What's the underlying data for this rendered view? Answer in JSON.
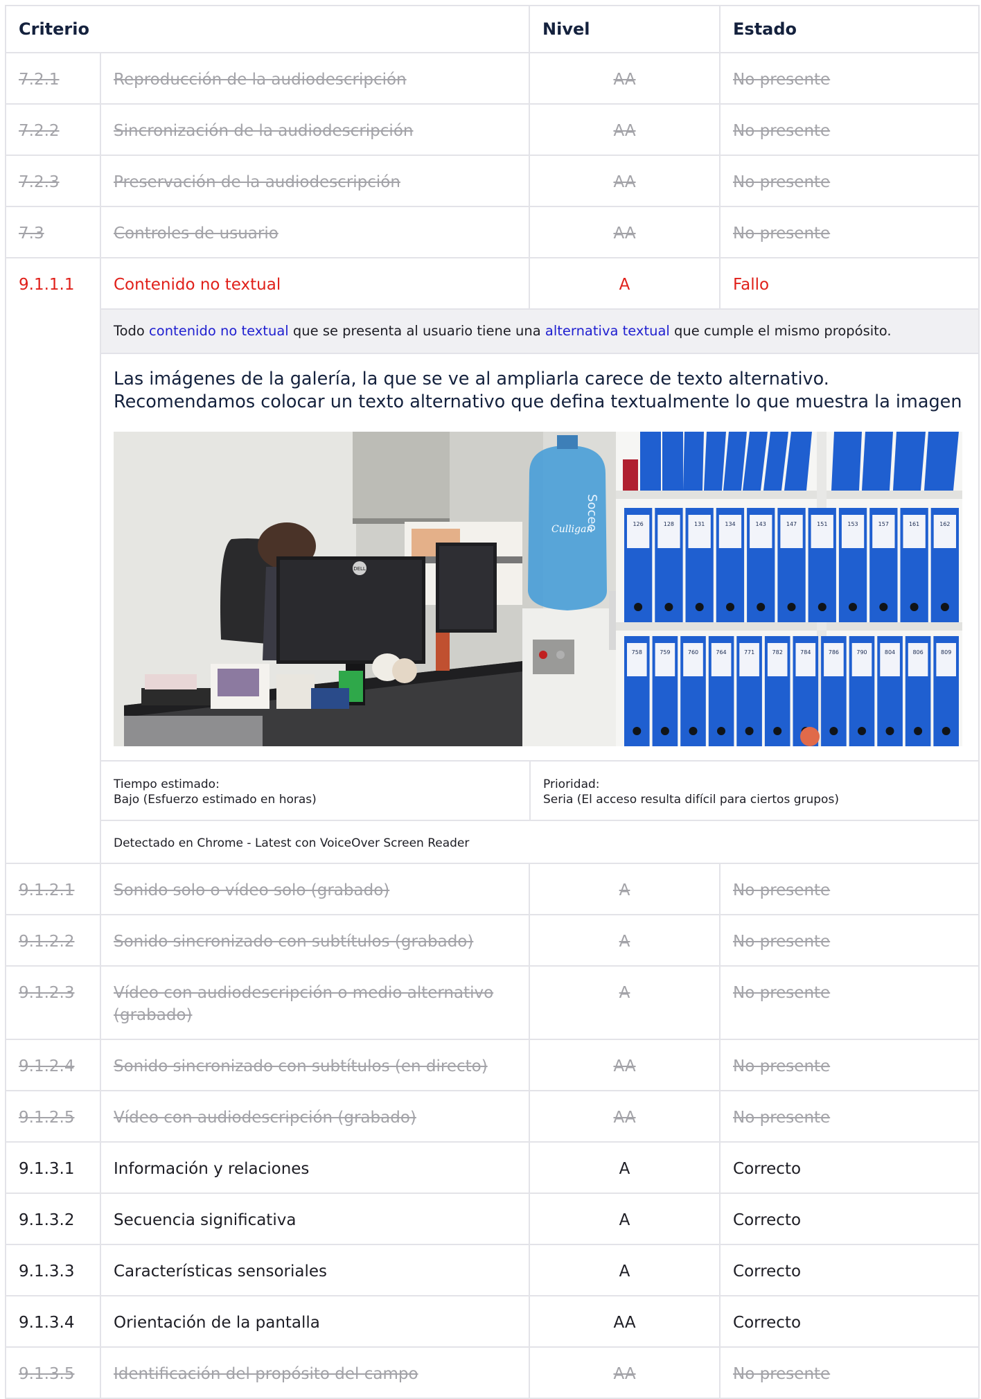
{
  "headers": {
    "criterio": "Criterio",
    "nivel": "Nivel",
    "estado": "Estado"
  },
  "rows_before": [
    {
      "id": "7.2.1",
      "name": "Reproducción de la audiodescripción",
      "level": "AA",
      "status": "No presente",
      "state": "na"
    },
    {
      "id": "7.2.2",
      "name": "Sincronización de la audiodescripción",
      "level": "AA",
      "status": "No presente",
      "state": "na"
    },
    {
      "id": "7.2.3",
      "name": "Preservación de la audiodescripción",
      "level": "AA",
      "status": "No presente",
      "state": "na"
    },
    {
      "id": "7.3",
      "name": "Controles de usuario",
      "level": "AA",
      "status": "No presente",
      "state": "na"
    }
  ],
  "fail_row": {
    "id": "9.1.1.1",
    "name": "Contenido no textual",
    "level": "A",
    "status": "Fallo",
    "criterion_text": {
      "part1": "Todo ",
      "link1": "contenido no textual",
      "part2": " que se presenta al usuario tiene una ",
      "link2": "alternativa textual",
      "part3": " que cumple el mismo propósito."
    },
    "finding_line1": "Las imágenes de la galería, la que se ve al ampliarla carece de texto alternativo.",
    "finding_line2": "Recomendamos colocar un texto alternativo que defina textualmente lo que muestra la imagen",
    "photo_labels": {
      "jug_brand": "Culligan",
      "jug_text": "Soceo",
      "monitor_brand": "DELL"
    },
    "binder_numbers_top": [
      "126",
      "128",
      "131",
      "134",
      "143",
      "147",
      "151",
      "153",
      "157",
      "161",
      "162"
    ],
    "binder_numbers_bottom": [
      "758",
      "759",
      "760",
      "764",
      "771",
      "782",
      "784",
      "786",
      "790",
      "804",
      "806",
      "809"
    ],
    "time_label": "Tiempo estimado:",
    "time_value": "Bajo (Esfuerzo estimado en horas)",
    "priority_label": "Prioridad:",
    "priority_value": "Seria (El acceso resulta difícil para ciertos grupos)",
    "detected": "Detectado en Chrome - Latest con VoiceOver Screen Reader"
  },
  "rows_after": [
    {
      "id": "9.1.2.1",
      "name": "Sonido solo o vídeo solo (grabado)",
      "level": "A",
      "status": "No presente",
      "state": "na"
    },
    {
      "id": "9.1.2.2",
      "name": "Sonido sincronizado con subtítulos (grabado)",
      "level": "A",
      "status": "No presente",
      "state": "na"
    },
    {
      "id": "9.1.2.3",
      "name": "Vídeo con audiodescripción o medio alternativo (grabado)",
      "level": "A",
      "status": "No presente",
      "state": "na"
    },
    {
      "id": "9.1.2.4",
      "name": "Sonido sincronizado con subtítulos (en directo)",
      "level": "AA",
      "status": "No presente",
      "state": "na"
    },
    {
      "id": "9.1.2.5",
      "name": "Vídeo con audiodescripción (grabado)",
      "level": "AA",
      "status": "No presente",
      "state": "na"
    },
    {
      "id": "9.1.3.1",
      "name": "Información y relaciones",
      "level": "A",
      "status": "Correcto",
      "state": "ok"
    },
    {
      "id": "9.1.3.2",
      "name": "Secuencia significativa",
      "level": "A",
      "status": "Correcto",
      "state": "ok"
    },
    {
      "id": "9.1.3.3",
      "name": "Características sensoriales",
      "level": "A",
      "status": "Correcto",
      "state": "ok"
    },
    {
      "id": "9.1.3.4",
      "name": "Orientación de la pantalla",
      "level": "AA",
      "status": "Correcto",
      "state": "ok"
    },
    {
      "id": "9.1.3.5",
      "name": "Identificación del propósito del campo",
      "level": "AA",
      "status": "No presente",
      "state": "na"
    }
  ],
  "colors": {
    "fail": "#e0201a",
    "na": "#a3a3a8",
    "link": "#2020d0",
    "border": "#e3e3e8",
    "binder": "#1f5fd0"
  }
}
